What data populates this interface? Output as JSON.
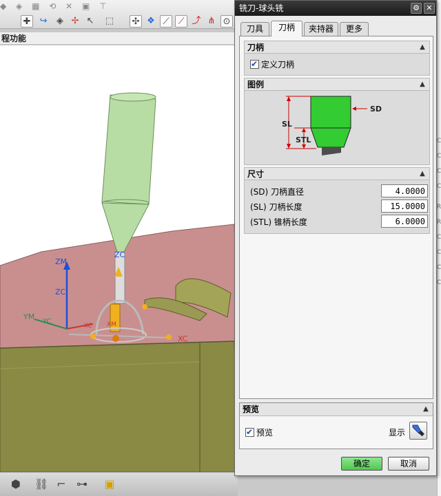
{
  "left_panel": {
    "function_label": "程功能",
    "axis_labels": {
      "zm": "ZM",
      "zc": "ZC",
      "zc2": "ZC",
      "ym": "YM",
      "yc": "YC",
      "xc": "XC",
      "xc2": "XC",
      "xm": "XM"
    }
  },
  "dialog": {
    "title": "铣刀-球头铣",
    "tabs": [
      {
        "label": "刀具"
      },
      {
        "label": "刀柄"
      },
      {
        "label": "夹持器"
      },
      {
        "label": "更多"
      }
    ],
    "active_tab": "刀柄",
    "sections": {
      "holder": {
        "title": "刀柄",
        "define_holder": {
          "label": "定义刀柄",
          "checked": true
        }
      },
      "legend": {
        "title": "图例",
        "labels": {
          "sd": "SD",
          "sl": "SL",
          "stl": "STL"
        },
        "colors": {
          "shank": "#33cc33",
          "tool": "#4d4d4d",
          "dim_line": "#cc0000"
        }
      },
      "dimensions": {
        "title": "尺寸",
        "rows": [
          {
            "label": "(SD) 刀柄直径",
            "value": "4.0000"
          },
          {
            "label": "(SL) 刀柄长度",
            "value": "15.0000"
          },
          {
            "label": "(STL) 锥柄长度",
            "value": "6.0000"
          }
        ]
      }
    },
    "preview": {
      "title": "预览",
      "preview_checkbox": {
        "label": "预览",
        "checked": true
      },
      "display_label": "显示"
    },
    "buttons": {
      "ok": "确定",
      "cancel": "取消"
    }
  },
  "colors": {
    "ok_button": "#4fc84f",
    "part_top": "#c98f8f",
    "part_side": "#8a8a45",
    "cone": "#b8dda4",
    "axis_blue": "#1f4fd6",
    "axis_orange": "#e8a000"
  }
}
